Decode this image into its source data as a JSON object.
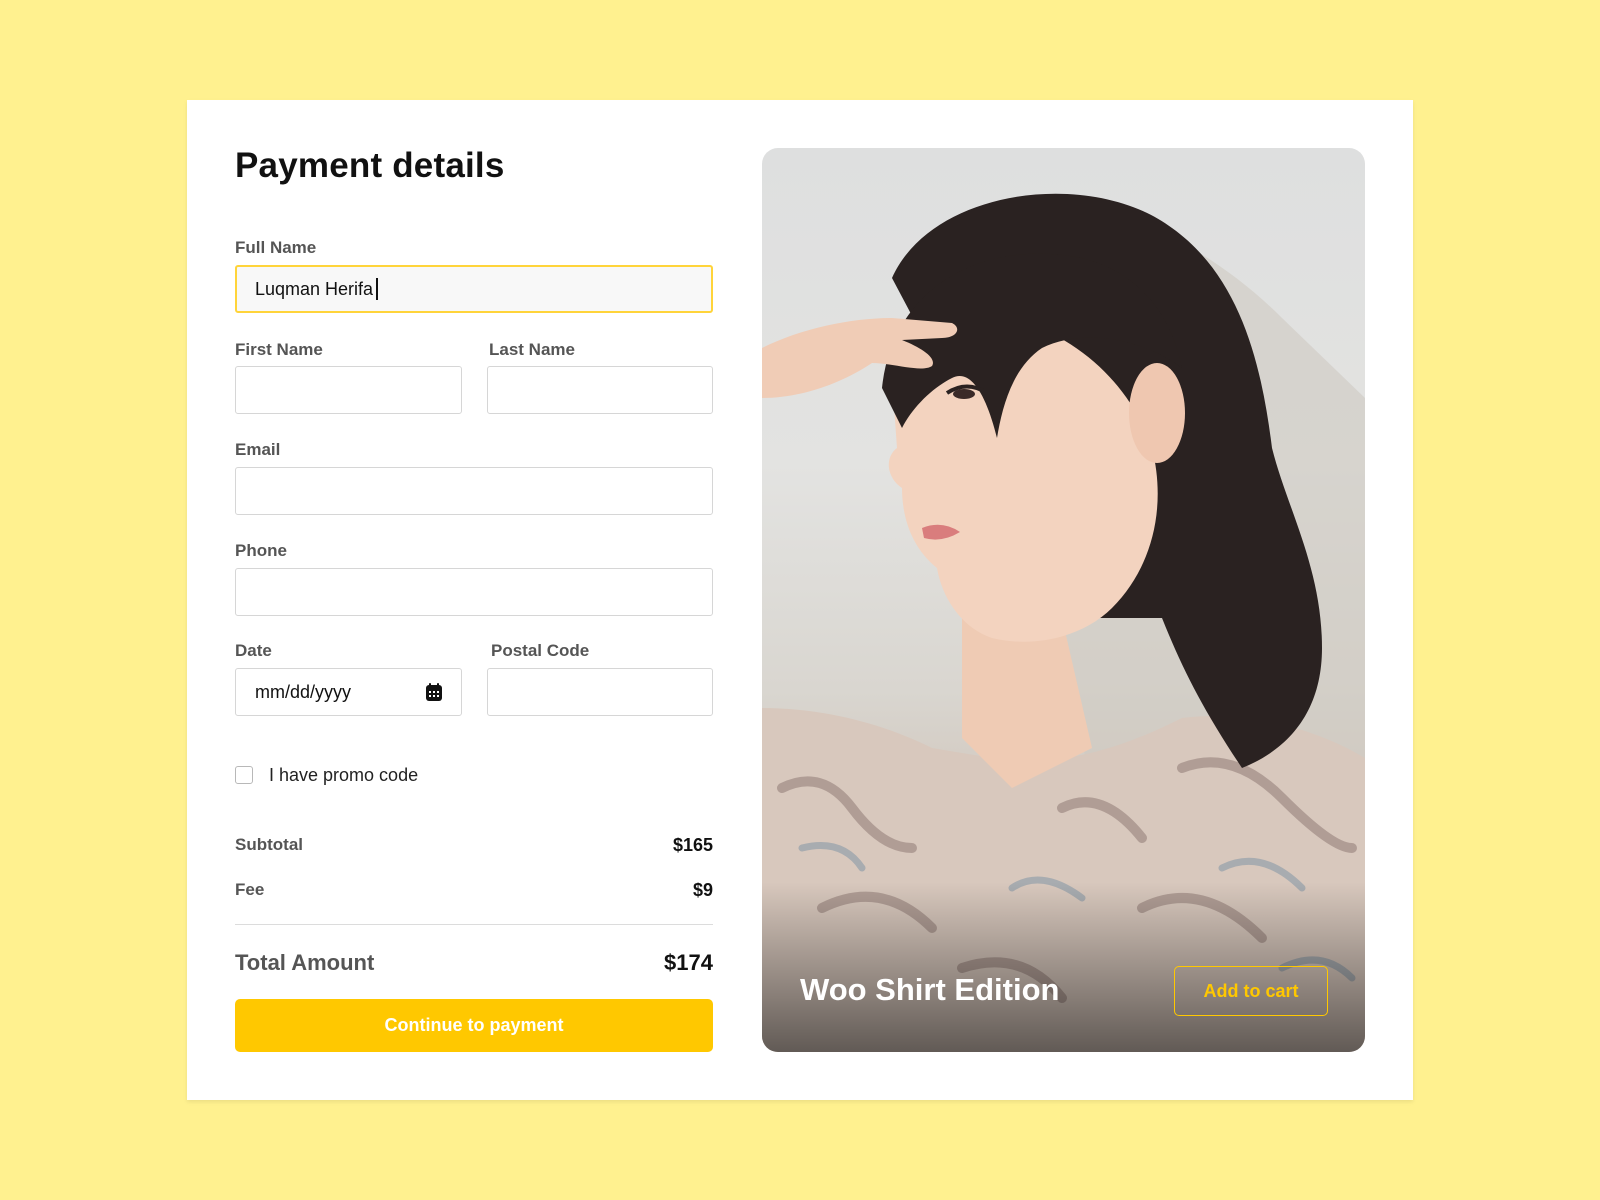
{
  "form": {
    "title": "Payment details",
    "full_name": {
      "label": "Full Name",
      "value": "Luqman Herifa"
    },
    "first_name": {
      "label": "First Name",
      "value": ""
    },
    "last_name": {
      "label": "Last Name",
      "value": ""
    },
    "email": {
      "label": "Email",
      "value": ""
    },
    "phone": {
      "label": "Phone",
      "value": ""
    },
    "date": {
      "label": "Date",
      "placeholder": "mm/dd/yyyy",
      "icon": "calendar-icon"
    },
    "postal_code": {
      "label": "Postal Code",
      "value": ""
    },
    "promo": {
      "label": "I have promo code",
      "checked": false
    }
  },
  "summary": {
    "subtotal_label": "Subtotal",
    "subtotal_value": "$165",
    "fee_label": "Fee",
    "fee_value": "$9",
    "total_label": "Total Amount",
    "total_value": "$174"
  },
  "actions": {
    "continue_label": "Continue to payment"
  },
  "product": {
    "name": "Woo Shirt Edition",
    "add_to_cart_label": "Add to cart"
  },
  "colors": {
    "background": "#fff18f",
    "accent": "#ffc800",
    "focus_border": "#ffd43a"
  }
}
